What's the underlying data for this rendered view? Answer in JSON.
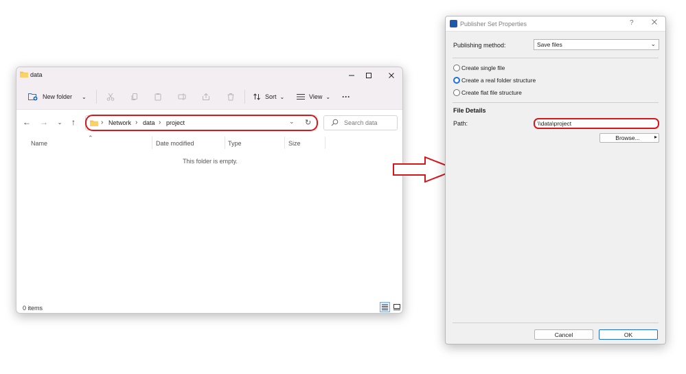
{
  "explorer": {
    "title": "data",
    "toolbar": {
      "new_folder_label": "New folder",
      "sort_label": "Sort",
      "view_label": "View",
      "more_label": "···"
    },
    "address": {
      "crumbs": [
        "Network",
        "data",
        "project"
      ]
    },
    "search": {
      "placeholder": "Search data"
    },
    "columns": [
      "Name",
      "Date modified",
      "Type",
      "Size"
    ],
    "empty_message": "This folder is empty.",
    "status": "0 items"
  },
  "dialog": {
    "title": "Publisher Set Properties",
    "help_label": "?",
    "publishing_method_label": "Publishing method:",
    "publishing_method_value": "Save files",
    "options": [
      {
        "label": "Create single file",
        "selected": false
      },
      {
        "label": "Create a real folder structure",
        "selected": true
      },
      {
        "label": "Create flat file structure",
        "selected": false
      }
    ],
    "section_title": "File Details",
    "path_label": "Path:",
    "path_value": "\\\\data\\project",
    "browse_label": "Browse...",
    "cancel_label": "Cancel",
    "ok_label": "OK"
  },
  "colors": {
    "highlight": "#d8151b",
    "accent": "#1c6ee0",
    "folder": "#f6c344"
  }
}
